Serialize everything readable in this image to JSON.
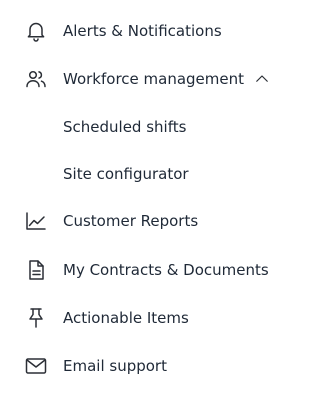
{
  "menu": {
    "alerts": {
      "label": "Alerts & Notifications",
      "icon": "bell-icon"
    },
    "workforce": {
      "label": "Workforce management",
      "icon": "users-icon",
      "expanded": true,
      "children": [
        {
          "label": "Scheduled shifts"
        },
        {
          "label": "Site configurator"
        }
      ]
    },
    "reports": {
      "label": "Customer Reports",
      "icon": "chart-line-icon"
    },
    "contracts": {
      "label": "My Contracts & Documents",
      "icon": "document-icon"
    },
    "actionable": {
      "label": "Actionable Items",
      "icon": "pin-icon"
    },
    "email": {
      "label": "Email support",
      "icon": "mail-icon"
    }
  }
}
